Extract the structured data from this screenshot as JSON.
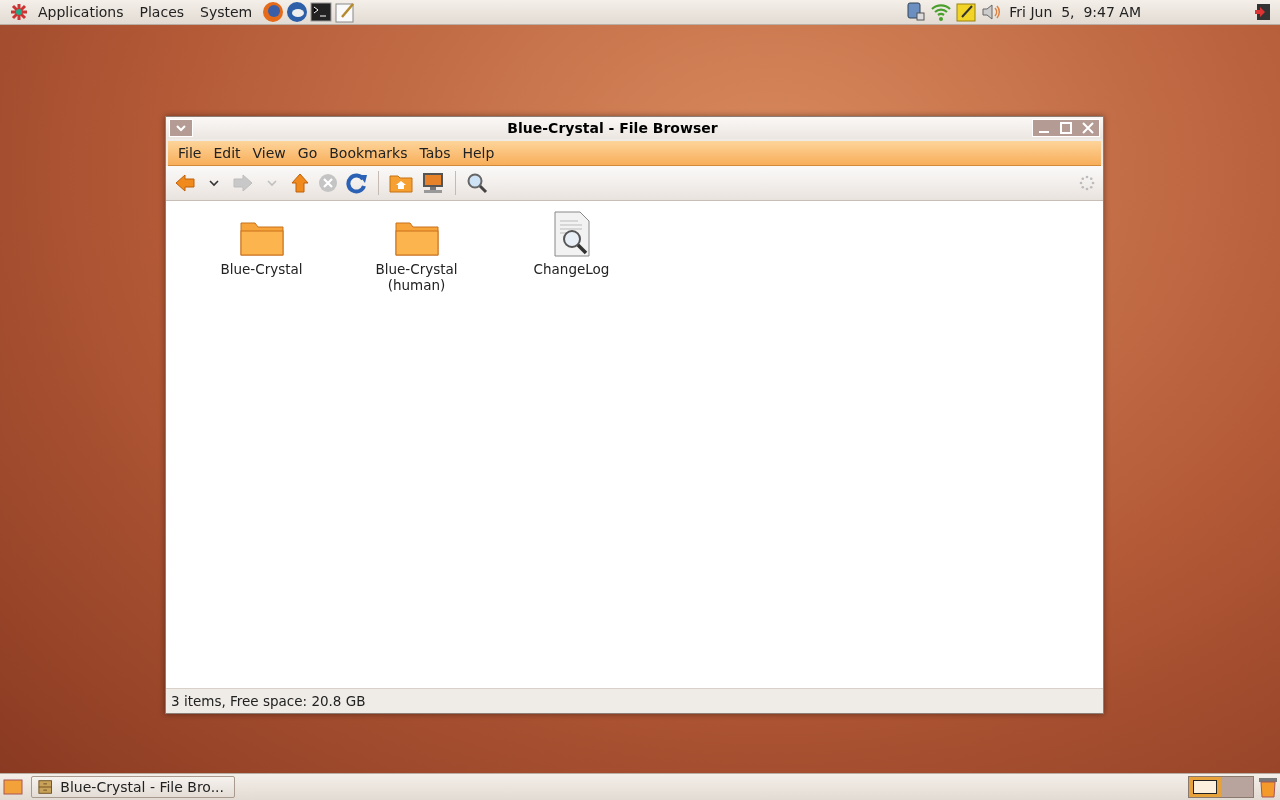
{
  "top_panel": {
    "menus": [
      "Applications",
      "Places",
      "System"
    ],
    "clock": "Fri Jun  5,  9:47 AM"
  },
  "window": {
    "title": "Blue-Crystal - File Browser",
    "menu_bar": [
      "File",
      "Edit",
      "View",
      "Go",
      "Bookmarks",
      "Tabs",
      "Help"
    ],
    "toolbar": [
      {
        "kind": "back",
        "disabled": false
      },
      {
        "kind": "dropdown",
        "disabled": false
      },
      {
        "kind": "forward",
        "disabled": true
      },
      {
        "kind": "dropdown",
        "disabled": true
      },
      {
        "kind": "up",
        "disabled": false
      },
      {
        "kind": "stop",
        "disabled": true
      },
      {
        "kind": "reload",
        "disabled": false
      },
      {
        "kind": "separator"
      },
      {
        "kind": "home",
        "disabled": false
      },
      {
        "kind": "computer",
        "disabled": false
      },
      {
        "kind": "separator"
      },
      {
        "kind": "search",
        "disabled": false
      }
    ],
    "files": [
      {
        "kind": "folder",
        "name": "Blue-Crystal"
      },
      {
        "kind": "folder",
        "name": "Blue-Crystal (human)"
      },
      {
        "kind": "document",
        "name": "ChangeLog"
      }
    ],
    "status_bar": "3 items, Free space: 20.8 GB"
  },
  "bottom_panel": {
    "tasks": [
      {
        "label": "Blue-Crystal - File Bro...",
        "selected": false
      }
    ],
    "workspaces": [
      {
        "selected": true
      },
      {
        "selected": false
      }
    ]
  }
}
